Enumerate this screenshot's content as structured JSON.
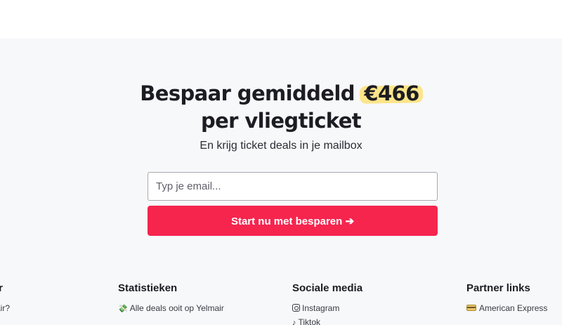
{
  "hero": {
    "headline_part1": "Bespaar gemiddeld ",
    "headline_highlight": "€466",
    "headline_part2": "per vliegticket",
    "subtitle": "En krijg ticket deals in je mailbox"
  },
  "signup": {
    "email_placeholder": "Typ je email...",
    "cta_label": "Start nu met besparen ➔"
  },
  "footer": {
    "col1": {
      "title": "ir",
      "link1": "air?"
    },
    "col2": {
      "title": "Statistieken",
      "link1_icon": "money-wings-icon",
      "link1": "Alle deals ooit op Yelmair"
    },
    "col3": {
      "title": "Sociale media",
      "link1_icon": "instagram-icon",
      "link1": "Instagram",
      "link2_icon": "tiktok-icon",
      "link2": "Tiktok"
    },
    "col4": {
      "title": "Partner links",
      "link1_icon": "credit-card-icon",
      "link1": "American Express"
    }
  },
  "colors": {
    "background": "#f7f8fa",
    "cta": "#f5254e",
    "highlight": "#fde58a"
  }
}
